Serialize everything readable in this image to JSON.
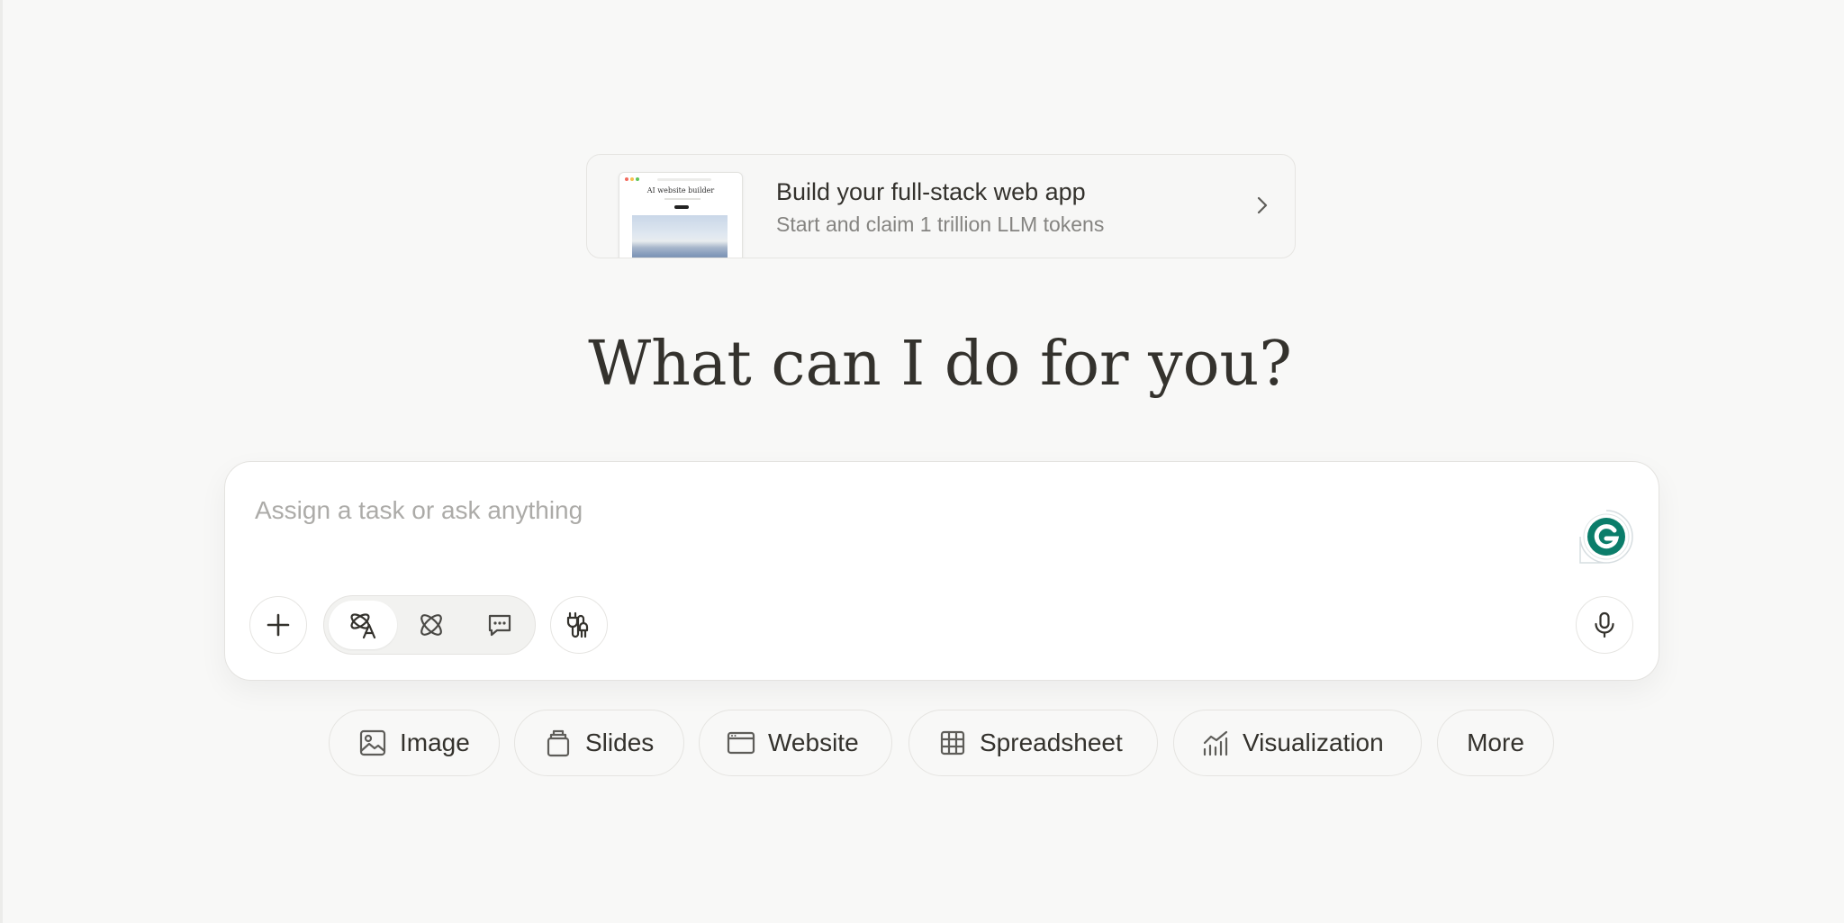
{
  "promo": {
    "thumbnail_title": "AI website builder",
    "title": "Build your full-stack web app",
    "subtitle": "Start and claim 1 trillion LLM tokens"
  },
  "heading": "What can I do for you?",
  "composer": {
    "placeholder": "Assign a task or ask anything",
    "value": "",
    "buttons": {
      "add": "plus-icon",
      "modes": [
        "agent-mode-icon",
        "atom-icon",
        "chat-bubble-icon"
      ],
      "active_mode": 0,
      "connectors": "connector-plug-icon",
      "voice": "microphone-icon"
    },
    "grammarly_brand_color": "#0b7d6a"
  },
  "quick_actions": [
    {
      "label": "Image",
      "icon": "image-icon"
    },
    {
      "label": "Slides",
      "icon": "slides-icon"
    },
    {
      "label": "Website",
      "icon": "browser-window-icon"
    },
    {
      "label": "Spreadsheet",
      "icon": "table-grid-icon"
    },
    {
      "label": "Visualization",
      "icon": "chart-icon"
    },
    {
      "label": "More",
      "icon": ""
    }
  ],
  "colors": {
    "background": "#f8f8f7",
    "text": "#34322d",
    "muted_text": "#858481",
    "placeholder": "#acaba8",
    "border": "#e5e4e1"
  }
}
